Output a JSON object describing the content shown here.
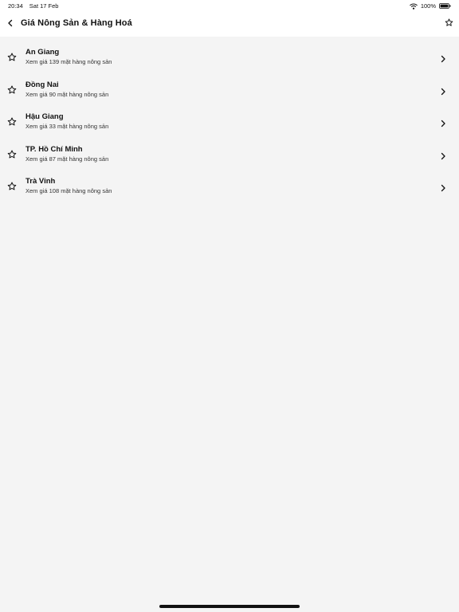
{
  "status_bar": {
    "time": "20:34",
    "date": "Sat 17 Feb",
    "battery": "100%"
  },
  "nav": {
    "title": "Giá Nông Sản & Hàng Hoá",
    "back_icon": "chevron-left-icon",
    "favorite_icon": "star-outline-icon"
  },
  "items": [
    {
      "title": "An Giang",
      "subtitle": "Xem giá 139 mặt hàng nông sản"
    },
    {
      "title": "Đồng Nai",
      "subtitle": "Xem giá 90 mặt hàng nông sản"
    },
    {
      "title": "Hậu Giang",
      "subtitle": "Xem giá 33 mặt hàng nông sản"
    },
    {
      "title": "TP. Hồ Chí Minh",
      "subtitle": "Xem giá 87 mặt hàng nông sản"
    },
    {
      "title": "Trà Vinh",
      "subtitle": "Xem giá 108 mặt hàng nông sản"
    }
  ],
  "colors": {
    "background": "#f4f4f4",
    "bar": "#ffffff",
    "text": "#111111"
  }
}
